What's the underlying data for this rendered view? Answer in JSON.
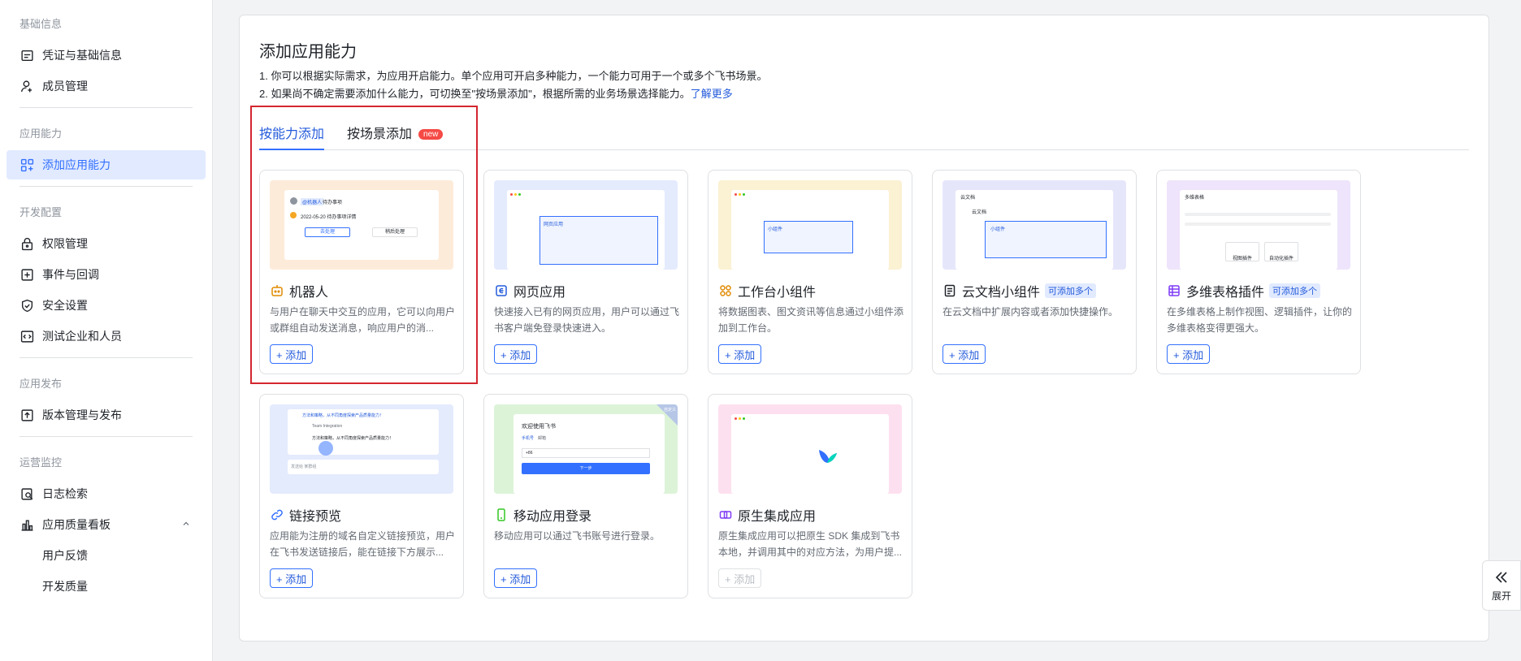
{
  "sidebar": {
    "sections": [
      {
        "title": "基础信息",
        "items": [
          {
            "label": "凭证与基础信息",
            "icon": "credential-icon"
          },
          {
            "label": "成员管理",
            "icon": "member-add-icon"
          }
        ]
      },
      {
        "title": "应用能力",
        "items": [
          {
            "label": "添加应用能力",
            "icon": "grid-add-icon",
            "active": true
          }
        ]
      },
      {
        "title": "开发配置",
        "items": [
          {
            "label": "权限管理",
            "icon": "lock-icon"
          },
          {
            "label": "事件与回调",
            "icon": "event-icon"
          },
          {
            "label": "安全设置",
            "icon": "shield-icon"
          },
          {
            "label": "测试企业和人员",
            "icon": "code-icon"
          }
        ]
      },
      {
        "title": "应用发布",
        "items": [
          {
            "label": "版本管理与发布",
            "icon": "upload-icon"
          }
        ]
      },
      {
        "title": "运营监控",
        "items": [
          {
            "label": "日志检索",
            "icon": "log-search-icon"
          },
          {
            "label": "应用质量看板",
            "icon": "bar-chart-icon",
            "expanded": true
          }
        ],
        "subitems": [
          {
            "label": "用户反馈"
          },
          {
            "label": "开发质量"
          }
        ]
      }
    ]
  },
  "main": {
    "title": "添加应用能力",
    "desc1": "1. 你可以根据实际需求，为应用开启能力。单个应用可开启多种能力，一个能力可用于一个或多个飞书场景。",
    "desc2": "2. 如果尚不确定需要添加什么能力，可切换至\"按场景添加\"，根据所需的业务场景选择能力。",
    "learn_more": "了解更多",
    "tabs": [
      {
        "label": "按能力添加",
        "active": true
      },
      {
        "label": "按场景添加",
        "badge": "new"
      }
    ],
    "add_label": "+ 添加",
    "cards": [
      {
        "title": "机器人",
        "icon": "robot-icon",
        "desc": "与用户在聊天中交互的应用，它可以向用户或群组自动发送消息，响应用户的消...",
        "thumb_color": "#fdebd9",
        "enabled": true,
        "thumb": {
          "tag": "@机器人",
          "tag2": "待办事项",
          "date": "2022-05-20 待办事项详情",
          "btn1": "去处理",
          "btn2": "稍后处理"
        }
      },
      {
        "title": "网页应用",
        "icon": "web-app-icon",
        "desc": "快速接入已有的网页应用，用户可以通过飞书客户端免登录快速进入。",
        "thumb_color": "#e4ebfd",
        "enabled": true,
        "thumb": {
          "label": "网页应用"
        }
      },
      {
        "title": "工作台小组件",
        "icon": "widget-icon",
        "desc": "将数据图表、图文资讯等信息通过小组件添加到工作台。",
        "thumb_color": "#fbf1d3",
        "enabled": true,
        "thumb": {
          "label": "小组件"
        }
      },
      {
        "title": "云文档小组件",
        "icon": "doc-icon",
        "tag": "可添加多个",
        "desc": "在云文档中扩展内容或者添加快捷操作。",
        "thumb_color": "#e6e6fb",
        "enabled": true,
        "thumb": {
          "header": "云文档",
          "sub": "云文档",
          "label": "小组件"
        }
      },
      {
        "title": "多维表格插件",
        "icon": "bitable-icon",
        "tag": "可添加多个",
        "desc": "在多维表格上制作视图、逻辑插件，让你的多维表格变得更强大。",
        "thumb_color": "#eee4fb",
        "enabled": true,
        "thumb": {
          "header": "多维表格",
          "btn1": "视图插件",
          "btn2": "自动化插件"
        }
      },
      {
        "title": "链接预览",
        "icon": "link-icon",
        "desc": "应用能为注册的域名自定义链接预览，用户在飞书发送链接后，能在链接下方展示...",
        "thumb_color": "#e4ebfd",
        "enabled": true,
        "thumb": {
          "msg": "方法和策略，从不同角度探索产品质量能力！",
          "title": "Team Integration",
          "msg2": "方法和策略，从不同角度探索产品质量能力！",
          "input": "发送给 某群组"
        }
      },
      {
        "title": "移动应用登录",
        "icon": "mobile-icon",
        "desc": "移动应用可以通过飞书账号进行登录。",
        "thumb_color": "#dcf3d8",
        "enabled": true,
        "thumb": {
          "welcome": "欢迎使用飞书",
          "tab1": "手机号",
          "tab2": "邮箱",
          "code": "+86",
          "btn": "下一步",
          "corner": "自定义"
        }
      },
      {
        "title": "原生集成应用",
        "icon": "native-icon",
        "desc": "原生集成应用可以把原生 SDK 集成到飞书本地，并调用其中的对应方法，为用户提...",
        "thumb_color": "#fde0ef",
        "enabled": false,
        "thumb": {}
      }
    ]
  },
  "expand": {
    "label": "展开"
  }
}
